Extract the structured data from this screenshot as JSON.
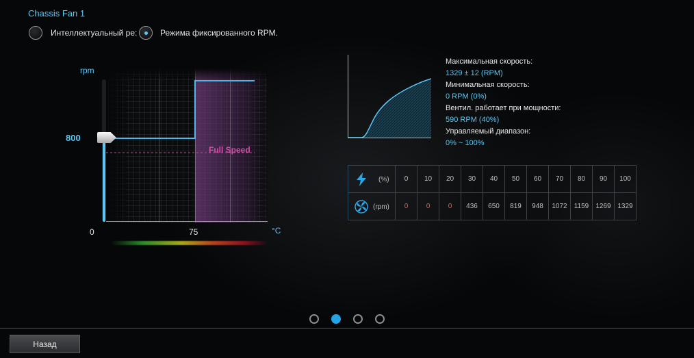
{
  "page": {
    "title": "Chassis Fan 1"
  },
  "modes": {
    "smart_label": "Интеллектуальный ре:",
    "fixed_label": "Режима фиксированного RPM."
  },
  "left_graph": {
    "y_axis_label": "rpm",
    "current_value": "800",
    "x_min_label": "0",
    "x_mid_label": "75",
    "x_unit_label": "°C",
    "full_speed_label": "Full Speed",
    "fixed_rpm": 800,
    "full_speed_temp": 75
  },
  "info": {
    "max_speed_label": "Максимальная скорость:",
    "max_speed_value": "1329 ± 12 (RPM)",
    "min_speed_label": "Минимальная скорость:",
    "min_speed_value": "0 RPM (0%)",
    "fan_runs_label": "Вентил. работает при мощности:",
    "fan_runs_value": "590 RPM (40%)",
    "range_label": "Управляемый диапазон:",
    "range_value": "0% ~ 100%"
  },
  "table": {
    "percent_unit": "(%)",
    "rpm_unit": "(rpm)",
    "percent": [
      "0",
      "10",
      "20",
      "30",
      "40",
      "50",
      "60",
      "70",
      "80",
      "90",
      "100"
    ],
    "rpm": [
      "0",
      "0",
      "0",
      "436",
      "650",
      "819",
      "948",
      "1072",
      "1159",
      "1269",
      "1329"
    ]
  },
  "pager": {
    "count": 4,
    "active_index": 1
  },
  "footer": {
    "back_label": "Назад"
  },
  "colors": {
    "accent": "#5cc6f3",
    "full_speed": "#d64da8",
    "zero_rpm": "#ff5050"
  }
}
